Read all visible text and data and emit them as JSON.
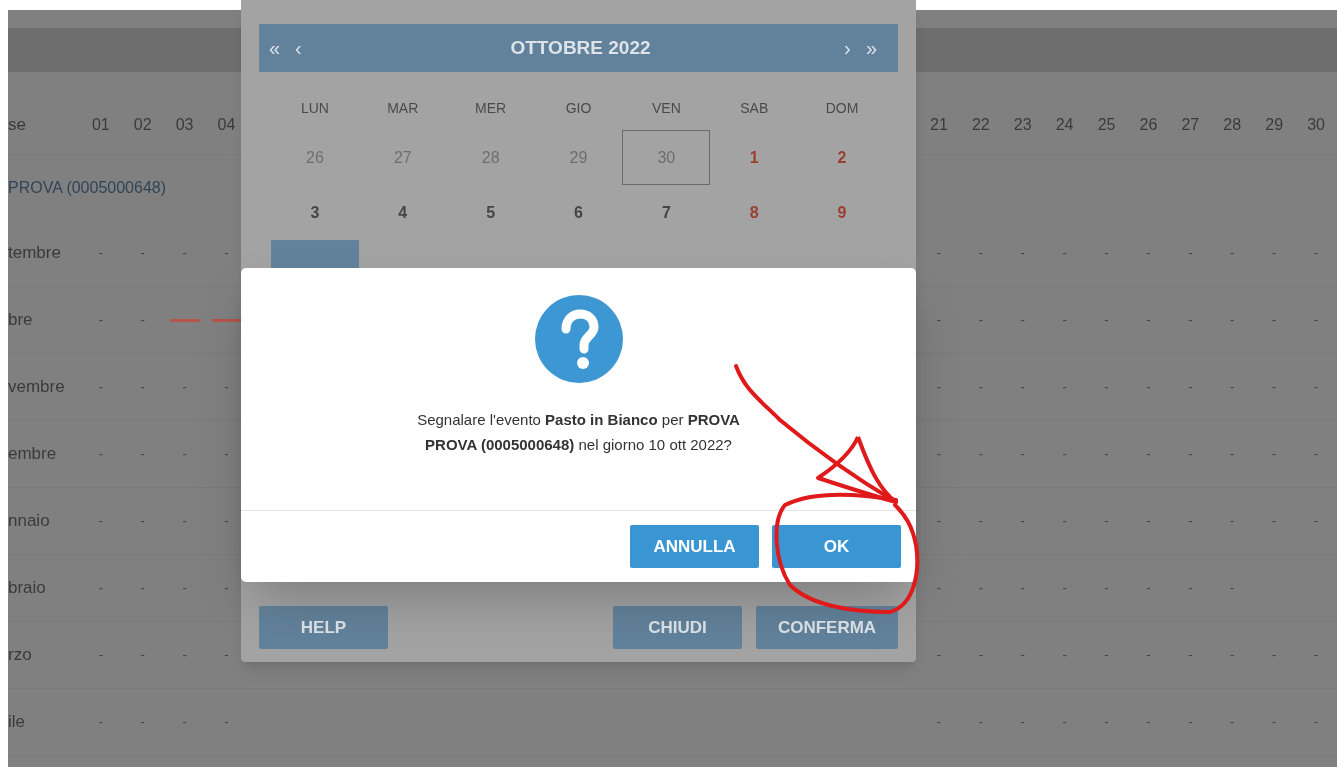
{
  "table": {
    "first_header": "se",
    "left_days": [
      "01",
      "02",
      "03",
      "04"
    ],
    "right_days": [
      "21",
      "22",
      "23",
      "24",
      "25",
      "26",
      "27",
      "28",
      "29",
      "30"
    ],
    "person": "PROVA (0005000648)",
    "rows": [
      {
        "label": "tembre",
        "left_cells": [
          {
            "kind": "dash",
            "text": "-"
          },
          {
            "kind": "dash",
            "text": "-"
          },
          {
            "kind": "dash",
            "text": "-"
          },
          {
            "kind": "dash",
            "text": "-"
          }
        ],
        "right_cells": [
          {
            "kind": "dash",
            "text": "-"
          },
          {
            "kind": "dash",
            "text": "-"
          },
          {
            "kind": "dash",
            "text": "-"
          },
          {
            "kind": "dash",
            "text": "-"
          },
          {
            "kind": "dash",
            "text": "-"
          },
          {
            "kind": "dash",
            "text": "-"
          },
          {
            "kind": "dash",
            "text": "-"
          },
          {
            "kind": "dash",
            "text": "-"
          },
          {
            "kind": "dash",
            "text": "-"
          },
          {
            "kind": "dash",
            "text": "-"
          }
        ]
      },
      {
        "label": "bre",
        "left_cells": [
          {
            "kind": "dash",
            "text": "-"
          },
          {
            "kind": "dash",
            "text": "-"
          },
          {
            "kind": "event",
            "color": "#b5554c"
          },
          {
            "kind": "event",
            "color": "#b5554c"
          }
        ],
        "right_cells": [
          {
            "kind": "dash",
            "text": "-"
          },
          {
            "kind": "dash",
            "text": "-"
          },
          {
            "kind": "dash",
            "text": "-"
          },
          {
            "kind": "dash",
            "text": "-"
          },
          {
            "kind": "dash",
            "text": "-"
          },
          {
            "kind": "dash",
            "text": "-"
          },
          {
            "kind": "dash",
            "text": "-"
          },
          {
            "kind": "dash",
            "text": "-"
          },
          {
            "kind": "dash",
            "text": "-"
          },
          {
            "kind": "dash",
            "text": "-"
          }
        ]
      },
      {
        "label": "vembre",
        "left_cells": [
          {
            "kind": "dash",
            "text": "-"
          },
          {
            "kind": "dash",
            "text": "-"
          },
          {
            "kind": "dash",
            "text": "-"
          },
          {
            "kind": "dash",
            "text": "-"
          }
        ],
        "right_cells": [
          {
            "kind": "dash",
            "text": "-"
          },
          {
            "kind": "dash",
            "text": "-"
          },
          {
            "kind": "dash",
            "text": "-"
          },
          {
            "kind": "dash",
            "text": "-"
          },
          {
            "kind": "dash",
            "text": "-"
          },
          {
            "kind": "dash",
            "text": "-"
          },
          {
            "kind": "dash",
            "text": "-"
          },
          {
            "kind": "dash",
            "text": "-"
          },
          {
            "kind": "dash",
            "text": "-"
          },
          {
            "kind": "dash",
            "text": "-"
          }
        ]
      },
      {
        "label": "embre",
        "left_cells": [
          {
            "kind": "dash",
            "text": "-"
          },
          {
            "kind": "dash",
            "text": "-"
          },
          {
            "kind": "dash",
            "text": "-"
          },
          {
            "kind": "dash",
            "text": "-"
          }
        ],
        "right_cells": [
          {
            "kind": "dash",
            "text": "-"
          },
          {
            "kind": "dash",
            "text": "-"
          },
          {
            "kind": "dash",
            "text": "-"
          },
          {
            "kind": "dash",
            "text": "-"
          },
          {
            "kind": "dash",
            "text": "-"
          },
          {
            "kind": "dash",
            "text": "-"
          },
          {
            "kind": "dash",
            "text": "-"
          },
          {
            "kind": "dash",
            "text": "-"
          },
          {
            "kind": "dash",
            "text": "-"
          },
          {
            "kind": "dash",
            "text": "-"
          }
        ]
      },
      {
        "label": "nnaio",
        "left_cells": [
          {
            "kind": "dash",
            "text": "-"
          },
          {
            "kind": "dash",
            "text": "-"
          },
          {
            "kind": "dash",
            "text": "-"
          },
          {
            "kind": "dash",
            "text": "-"
          }
        ],
        "right_cells": [
          {
            "kind": "dash",
            "text": "-"
          },
          {
            "kind": "dash",
            "text": "-"
          },
          {
            "kind": "dash",
            "text": "-"
          },
          {
            "kind": "dash",
            "text": "-"
          },
          {
            "kind": "dash",
            "text": "-"
          },
          {
            "kind": "dash",
            "text": "-"
          },
          {
            "kind": "dash",
            "text": "-"
          },
          {
            "kind": "dash",
            "text": "-"
          },
          {
            "kind": "dash",
            "text": "-"
          },
          {
            "kind": "dash",
            "text": "-"
          }
        ]
      },
      {
        "label": "braio",
        "left_cells": [
          {
            "kind": "dash",
            "text": "-"
          },
          {
            "kind": "dash",
            "text": "-"
          },
          {
            "kind": "dash",
            "text": "-"
          },
          {
            "kind": "dash",
            "text": "-"
          }
        ],
        "right_cells": [
          {
            "kind": "dash",
            "text": "-"
          },
          {
            "kind": "dash",
            "text": "-"
          },
          {
            "kind": "dash",
            "text": "-"
          },
          {
            "kind": "dash",
            "text": "-"
          },
          {
            "kind": "dash",
            "text": "-"
          },
          {
            "kind": "dash",
            "text": "-"
          },
          {
            "kind": "dash",
            "text": "-"
          },
          {
            "kind": "dash",
            "text": "-"
          },
          {
            "kind": "blank"
          },
          {
            "kind": "blank"
          }
        ]
      },
      {
        "label": "rzo",
        "left_cells": [
          {
            "kind": "dash",
            "text": "-"
          },
          {
            "kind": "dash",
            "text": "-"
          },
          {
            "kind": "dash",
            "text": "-"
          },
          {
            "kind": "dash",
            "text": "-"
          }
        ],
        "right_cells": [
          {
            "kind": "dash",
            "text": "-"
          },
          {
            "kind": "dash",
            "text": "-"
          },
          {
            "kind": "dash",
            "text": "-"
          },
          {
            "kind": "dash",
            "text": "-"
          },
          {
            "kind": "dash",
            "text": "-"
          },
          {
            "kind": "dash",
            "text": "-"
          },
          {
            "kind": "dash",
            "text": "-"
          },
          {
            "kind": "dash",
            "text": "-"
          },
          {
            "kind": "dash",
            "text": "-"
          },
          {
            "kind": "dash",
            "text": "-"
          }
        ]
      },
      {
        "label": "ile",
        "left_cells": [
          {
            "kind": "dash",
            "text": "-"
          },
          {
            "kind": "dash",
            "text": "-"
          },
          {
            "kind": "dash",
            "text": "-"
          },
          {
            "kind": "dash",
            "text": "-"
          }
        ],
        "right_cells": [
          {
            "kind": "dash",
            "text": "-"
          },
          {
            "kind": "dash",
            "text": "-"
          },
          {
            "kind": "dash",
            "text": "-"
          },
          {
            "kind": "dash",
            "text": "-"
          },
          {
            "kind": "dash",
            "text": "-"
          },
          {
            "kind": "dash",
            "text": "-"
          },
          {
            "kind": "dash",
            "text": "-"
          },
          {
            "kind": "dash",
            "text": "-"
          },
          {
            "kind": "dash",
            "text": "-"
          },
          {
            "kind": "dash",
            "text": "-"
          }
        ]
      }
    ]
  },
  "calendar": {
    "nav": [
      "«",
      "‹",
      "›",
      "»"
    ],
    "title": "OTTOBRE 2022",
    "weekdays": [
      "LUN",
      "MAR",
      "MER",
      "GIO",
      "VEN",
      "SAB",
      "DOM"
    ],
    "weeks": [
      [
        {
          "text": "26",
          "outside": true,
          "today": false,
          "selected": false
        },
        {
          "text": "27",
          "outside": true,
          "today": false,
          "selected": false
        },
        {
          "text": "28",
          "outside": true,
          "today": false,
          "selected": false
        },
        {
          "text": "29",
          "outside": true,
          "today": false,
          "selected": false
        },
        {
          "text": "30",
          "outside": true,
          "today": true,
          "selected": false
        },
        {
          "text": "1",
          "outside": false,
          "today": false,
          "selected": false
        },
        {
          "text": "2",
          "outside": false,
          "today": false,
          "selected": false
        }
      ],
      [
        {
          "text": "3",
          "outside": false,
          "today": false,
          "selected": false
        },
        {
          "text": "4",
          "outside": false,
          "today": false,
          "selected": false
        },
        {
          "text": "5",
          "outside": false,
          "today": false,
          "selected": false
        },
        {
          "text": "6",
          "outside": false,
          "today": false,
          "selected": false
        },
        {
          "text": "7",
          "outside": false,
          "today": false,
          "selected": false
        },
        {
          "text": "8",
          "outside": false,
          "today": false,
          "selected": false
        },
        {
          "text": "9",
          "outside": false,
          "today": false,
          "selected": false
        }
      ],
      [
        {
          "selected": true
        },
        {
          "selected": false
        },
        {
          "selected": false
        },
        {
          "selected": false
        },
        {
          "selected": false
        },
        {
          "selected": false
        },
        {
          "selected": false
        }
      ]
    ],
    "buttons": [
      "HELP",
      "CHIUDI",
      "CONFERMA"
    ]
  },
  "confirm_dialog": {
    "message": "Segnalare l'evento **Pasto in Bianco** per **PROVA PROVA (0005000648)** nel giorno 10 ott 2022?",
    "buttons": [
      "ANNULLA",
      "OK"
    ]
  }
}
